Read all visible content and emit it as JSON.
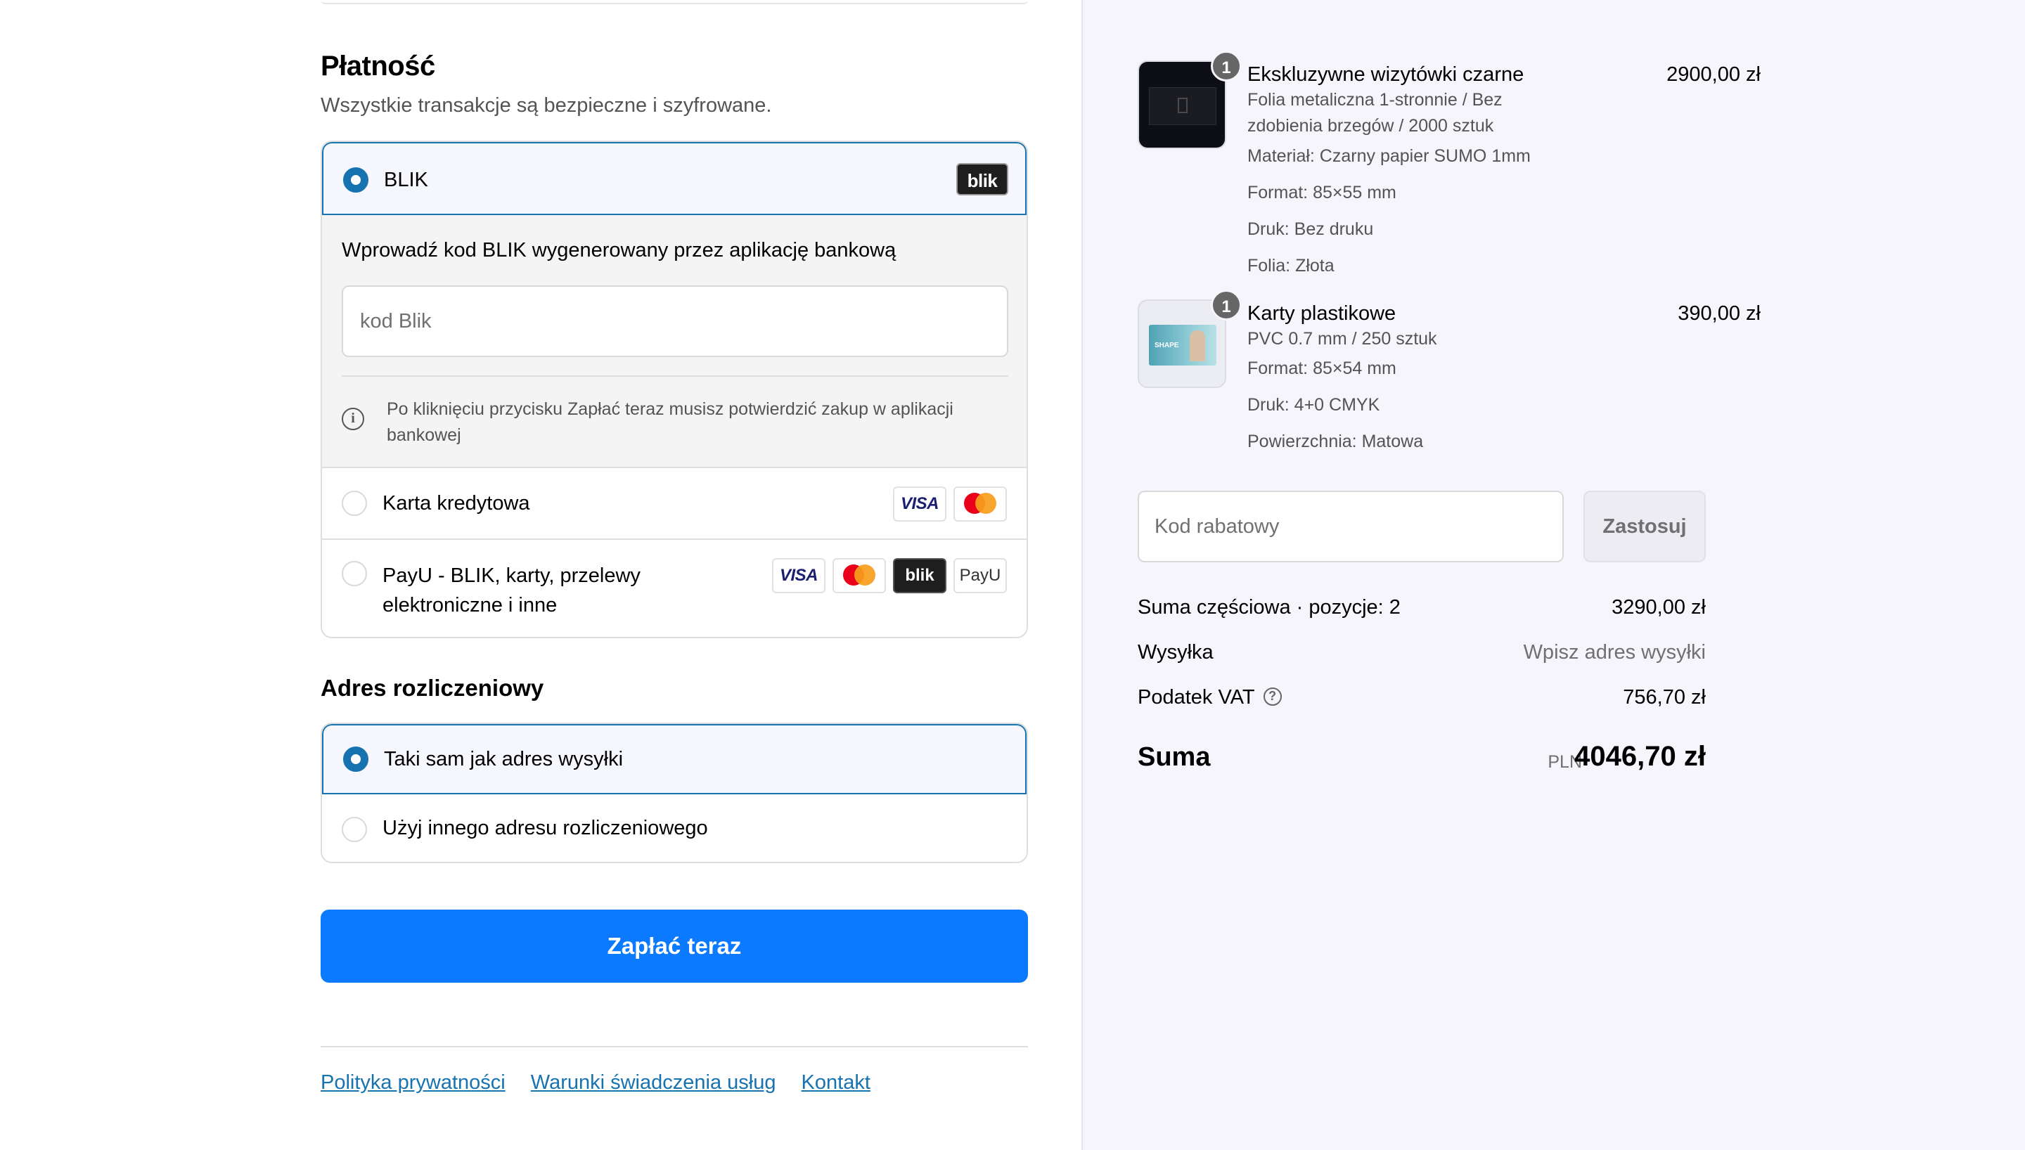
{
  "payment": {
    "heading": "Płatność",
    "subheading": "Wszystkie transakcje są bezpieczne i szyfrowane.",
    "options": [
      {
        "label": "BLIK",
        "selected": true,
        "brands": [
          "blik"
        ]
      },
      {
        "label": "Karta kredytowa",
        "selected": false,
        "brands": [
          "visa",
          "mastercard"
        ]
      },
      {
        "label": "PayU - BLIK, karty, przelewy elektroniczne i inne",
        "selected": false,
        "brands": [
          "visa",
          "mastercard",
          "blik",
          "payu"
        ]
      }
    ],
    "blik": {
      "instruction": "Wprowadź kod BLIK wygenerowany przez aplikację bankową",
      "placeholder": "kod Blik",
      "value": "",
      "info": "Po kliknięciu przycisku Zapłać teraz musisz potwierdzić zakup w aplikacji bankowej",
      "logo_text": "blik"
    },
    "brand_labels": {
      "visa": "VISA",
      "blik": "blik",
      "payu": "PayU"
    }
  },
  "billing": {
    "heading": "Adres rozliczeniowy",
    "options": [
      {
        "label": "Taki sam jak adres wysyłki",
        "selected": true
      },
      {
        "label": "Użyj innego adresu rozliczeniowego",
        "selected": false
      }
    ]
  },
  "pay_button": "Zapłać teraz",
  "footer_links": [
    "Polityka prywatności",
    "Warunki świadczenia usług",
    "Kontakt"
  ],
  "summary": {
    "items": [
      {
        "qty": "1",
        "title": "Ekskluzywne wizytówki czarne",
        "price": "2900,00 zł",
        "variant": "Folia metaliczna 1-stronnie / Bez zdobienia brzegów / 2000 sztuk",
        "details": [
          "Materiał: Czarny papier SUMO 1mm",
          "Format: 85×55 mm",
          "Druk: Bez druku",
          "Folia: Złota"
        ]
      },
      {
        "qty": "1",
        "title": "Karty plastikowe",
        "price": "390,00 zł",
        "variant": "PVC 0.7 mm / 250 sztuk",
        "details": [
          "Format: 85×54 mm",
          "Druk: 4+0 CMYK",
          "Powierzchnia: Matowa"
        ]
      }
    ],
    "discount": {
      "placeholder": "Kod rabatowy",
      "value": "",
      "button": "Zastosuj"
    },
    "subtotal_label": "Suma częściowa · pozycje: 2",
    "subtotal_value": "3290,00 zł",
    "shipping_label": "Wysyłka",
    "shipping_value": "Wpisz adres wysyłki",
    "tax_label": "Podatek VAT",
    "tax_value": "756,70 zł",
    "total_label": "Suma",
    "total_currency": "PLN",
    "total_value": "4046,70 zł"
  },
  "colors": {
    "accent": "#1773b0",
    "button": "#0c7aff",
    "summary_bg": "#f5f5fb"
  }
}
